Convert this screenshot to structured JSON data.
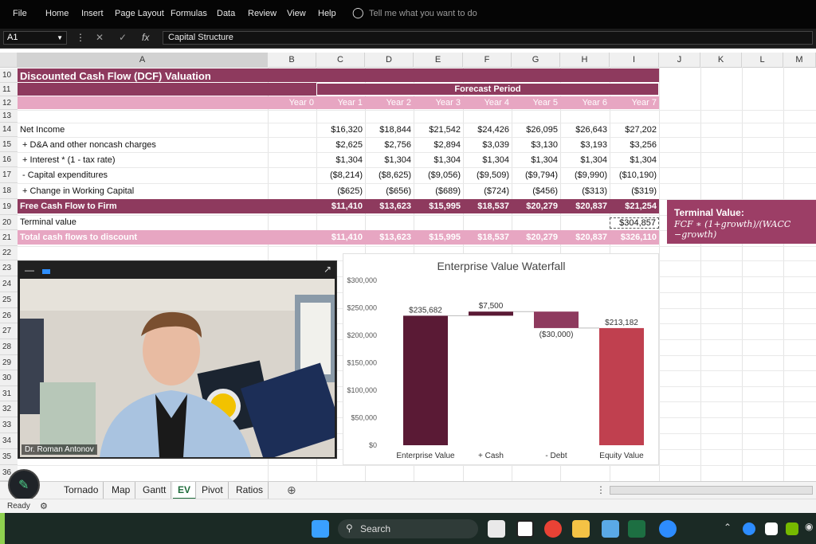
{
  "menu": {
    "items": [
      "File",
      "Home",
      "Insert",
      "Page Layout",
      "Formulas",
      "Data",
      "Review",
      "View",
      "Help"
    ],
    "search_placeholder": "Tell me what you want to do"
  },
  "formula_bar": {
    "name_box": "A1",
    "formula": "Capital Structure"
  },
  "columns": [
    "A",
    "B",
    "C",
    "D",
    "E",
    "F",
    "G",
    "H",
    "I",
    "J",
    "K",
    "L",
    "M"
  ],
  "rows": [
    "10",
    "11",
    "12",
    "13",
    "14",
    "15",
    "16",
    "17",
    "18",
    "19",
    "20",
    "21",
    "22",
    "23",
    "24",
    "25",
    "26",
    "27",
    "28",
    "29",
    "30",
    "31",
    "32",
    "33",
    "34",
    "35",
    "36"
  ],
  "sheet": {
    "title": "Discounted Cash Flow (DCF) Valuation",
    "forecast_label": "Forecast Period",
    "year_headers": [
      "Year 0",
      "Year 1",
      "Year 2",
      "Year 3",
      "Year 4",
      "Year 5",
      "Year 6",
      "Year 7"
    ],
    "line_items": [
      {
        "label": "Net Income",
        "values": [
          "$16,320",
          "$18,844",
          "$21,542",
          "$24,426",
          "$26,095",
          "$26,643",
          "$27,202"
        ]
      },
      {
        "label": " + D&A and other noncash charges",
        "values": [
          "$2,625",
          "$2,756",
          "$2,894",
          "$3,039",
          "$3,130",
          "$3,193",
          "$3,256"
        ]
      },
      {
        "label": " + Interest * (1 - tax rate)",
        "values": [
          "$1,304",
          "$1,304",
          "$1,304",
          "$1,304",
          "$1,304",
          "$1,304",
          "$1,304"
        ]
      },
      {
        "label": " - Capital expenditures",
        "values": [
          "($8,214)",
          "($8,625)",
          "($9,056)",
          "($9,509)",
          "($9,794)",
          "($9,990)",
          "($10,190)"
        ]
      },
      {
        "label": " + Change in Working Capital",
        "values": [
          "($625)",
          "($656)",
          "($689)",
          "($724)",
          "($456)",
          "($313)",
          "($319)"
        ]
      }
    ],
    "fcf": {
      "label": "Free Cash Flow to Firm",
      "values": [
        "$11,410",
        "$13,623",
        "$15,995",
        "$18,537",
        "$20,279",
        "$20,837",
        "$21,254"
      ]
    },
    "terminal": {
      "label": "Terminal value",
      "value": "$304,857"
    },
    "total": {
      "label": "Total cash flows to discount",
      "values": [
        "$11,410",
        "$13,623",
        "$15,995",
        "$18,537",
        "$20,279",
        "$20,837",
        "$326,110"
      ]
    }
  },
  "terminal_box": {
    "title": "Terminal Value:",
    "formula_line1": "FCF ∗ (1+growth)/(WACC",
    "formula_line2": "−growth)"
  },
  "video": {
    "name": "Dr. Roman Antonov"
  },
  "chart_data": {
    "type": "bar",
    "title": "Enterprise Value Waterfall",
    "categories": [
      "Enterprise Value",
      "+ Cash",
      "- Debt",
      "Equity Value"
    ],
    "values": [
      235682,
      7500,
      -30000,
      213182
    ],
    "data_labels": [
      "$235,682",
      "$7,500",
      "($30,000)",
      "$213,182"
    ],
    "y_ticks": [
      "$0",
      "$50,000",
      "$100,000",
      "$150,000",
      "$200,000",
      "$250,000",
      "$300,000"
    ],
    "ylim": [
      0,
      300000
    ],
    "colors": [
      "#5a1a35",
      "#5a1a35",
      "#8e3a5e",
      "#c0404f"
    ]
  },
  "tabs": [
    "Tornado",
    "Map",
    "Gantt",
    "EV",
    "Pivot",
    "Ratios"
  ],
  "active_tab": "EV",
  "status": {
    "ready": "Ready"
  },
  "taskbar": {
    "search": "Search"
  },
  "colors": {
    "band_dark": "#8e3a5e",
    "band_light": "#e7a6c2",
    "excel_green": "#1e6b3a"
  }
}
